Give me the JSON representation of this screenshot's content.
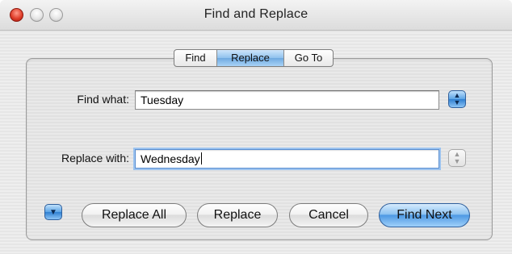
{
  "window": {
    "title": "Find and Replace"
  },
  "tabs": [
    {
      "label": "Find",
      "selected": false
    },
    {
      "label": "Replace",
      "selected": true
    },
    {
      "label": "Go To",
      "selected": false
    }
  ],
  "find": {
    "label": "Find what:",
    "value": "Tuesday"
  },
  "replace": {
    "label": "Replace with:",
    "value": "Wednesday"
  },
  "buttons": {
    "replace_all": "Replace All",
    "replace": "Replace",
    "cancel": "Cancel",
    "find_next": "Find Next"
  },
  "icons": {
    "find_options": "up-down-arrows-icon",
    "replace_options": "up-down-arrows-icon",
    "more_options": "chevron-down-icon"
  },
  "colors": {
    "accent": "#5aa3e5",
    "focus_ring": "#9cc3ef"
  }
}
